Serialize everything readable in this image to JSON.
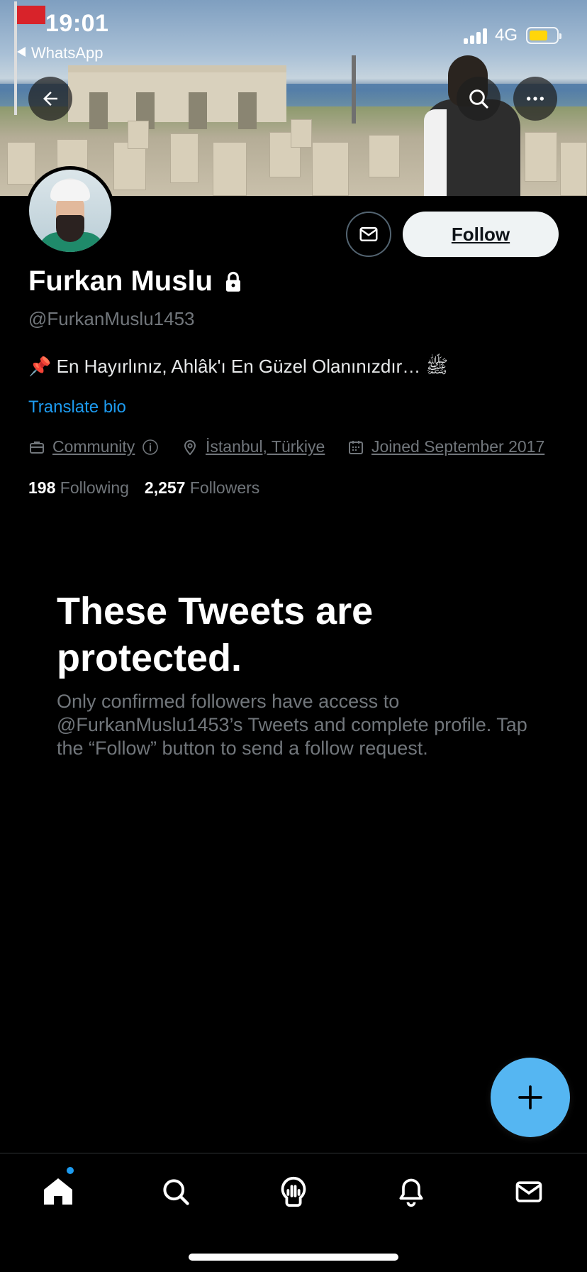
{
  "status_bar": {
    "time": "19:01",
    "back_app": "WhatsApp",
    "network": "4G",
    "battery_level": 0.7,
    "battery_color": "#ffd60a"
  },
  "header": {
    "back_icon": "arrow-left-icon",
    "search_icon": "search-icon",
    "more_icon": "more-icon"
  },
  "profile": {
    "display_name": "Furkan Muslu",
    "protected_icon": "lock-icon",
    "handle": "@FurkanMuslu1453",
    "bio": "📌 En Hayırlınız, Ahlâk'ı En Güzel Olanınızdır… ﷺ",
    "translate_label": "Translate bio",
    "follow_label": "Follow",
    "message_icon": "envelope-icon",
    "category": "Community",
    "location": "İstanbul, Türkiye",
    "joined": "Joined September 2017",
    "following_count": "198",
    "following_label": "Following",
    "followers_count": "2,257",
    "followers_label": "Followers"
  },
  "protected": {
    "title": "These Tweets are protected.",
    "description": "Only confirmed followers have access to @FurkanMuslu1453’s Tweets and complete profile. Tap the “Follow” button to send a follow request."
  },
  "colors": {
    "accent": "#1d9bf0",
    "background": "#000000",
    "muted_text": "#71767b"
  },
  "tab_bar": {
    "items": [
      "home-icon",
      "search-icon",
      "spaces-icon",
      "notifications-icon",
      "messages-icon"
    ]
  }
}
